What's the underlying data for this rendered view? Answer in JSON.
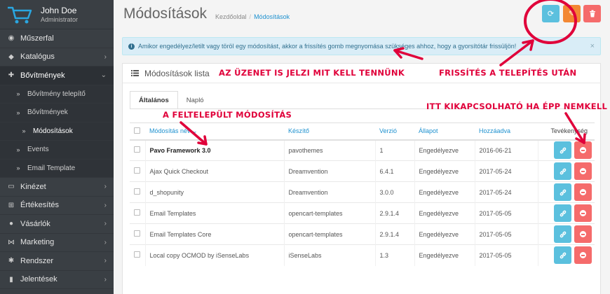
{
  "profile": {
    "name": "John Doe",
    "role": "Administrator"
  },
  "sidebar": {
    "items": [
      {
        "label": "Műszerfal",
        "icon": "dashboard-icon",
        "glyph": "◉",
        "chevron": ""
      },
      {
        "label": "Katalógus",
        "icon": "tag-icon",
        "glyph": "◆",
        "chevron": "›"
      },
      {
        "label": "Bővítmények",
        "icon": "puzzle-icon",
        "glyph": "✚",
        "chevron": "⌄"
      },
      {
        "label": "Bővítmény telepítő",
        "icon": "double-chevron-icon",
        "glyph": "»",
        "chevron": ""
      },
      {
        "label": "Bővítmények",
        "icon": "double-chevron-icon",
        "glyph": "»",
        "chevron": ""
      },
      {
        "label": "Módosítások",
        "icon": "double-chevron-icon",
        "glyph": "»",
        "chevron": ""
      },
      {
        "label": "Events",
        "icon": "double-chevron-icon",
        "glyph": "»",
        "chevron": ""
      },
      {
        "label": "Email Template",
        "icon": "double-chevron-icon",
        "glyph": "»",
        "chevron": ""
      },
      {
        "label": "Kinézet",
        "icon": "monitor-icon",
        "glyph": "▭",
        "chevron": "›"
      },
      {
        "label": "Értékesítés",
        "icon": "cart-icon",
        "glyph": "⊞",
        "chevron": "›"
      },
      {
        "label": "Vásárlók",
        "icon": "user-icon",
        "glyph": "●",
        "chevron": "›"
      },
      {
        "label": "Marketing",
        "icon": "share-icon",
        "glyph": "⋈",
        "chevron": "›"
      },
      {
        "label": "Rendszer",
        "icon": "cog-icon",
        "glyph": "✱",
        "chevron": "›"
      },
      {
        "label": "Jelentések",
        "icon": "chart-icon",
        "glyph": "▮",
        "chevron": "›"
      }
    ]
  },
  "header": {
    "title": "Módosítások",
    "breadcrumb": [
      "Kezdőoldal",
      "/",
      "Módosítások"
    ],
    "buttons": {
      "refresh": "⟳",
      "clear": "✎",
      "delete": "🗑"
    }
  },
  "alert": {
    "text": "Amikor engedélyez/letilt vagy töröl egy módosítást, akkor a frissítés gomb megnyomása szükséges ahhoz, hogy a gyorsítótár frissüljön!",
    "close": "×",
    "info": "i"
  },
  "panel": {
    "title": "Módosítások lista"
  },
  "tabs": [
    "Általános",
    "Napló"
  ],
  "table": {
    "headers": [
      "Módosítás név ⌄",
      "Készítő",
      "Verzió",
      "Állapot",
      "Hozzáadva",
      "Tevékenység"
    ],
    "rows": [
      {
        "name": "Pavo Framework 3.0",
        "author": "pavothemes",
        "version": "1",
        "status": "Engedélyezve",
        "date": "2016-06-21"
      },
      {
        "name": "Ajax Quick Checkout",
        "author": "Dreamvention",
        "version": "6.4.1",
        "status": "Engedélyezve",
        "date": "2017-05-24"
      },
      {
        "name": "d_shopunity",
        "author": "Dreamvention",
        "version": "3.0.0",
        "status": "Engedélyezve",
        "date": "2017-05-24"
      },
      {
        "name": "Email Templates",
        "author": "opencart-templates",
        "version": "2.9.1.4",
        "status": "Engedélyezve",
        "date": "2017-05-05"
      },
      {
        "name": "Email Templates Core",
        "author": "opencart-templates",
        "version": "2.9.1.4",
        "status": "Engedélyezve",
        "date": "2017-05-05"
      },
      {
        "name": "Local copy OCMOD by iSenseLabs",
        "author": "iSenseLabs",
        "version": "1.3",
        "status": "Engedélyezve",
        "date": "2017-05-05"
      }
    ]
  },
  "annotations": {
    "message": "AZ ÜZENET IS JELZI MIT KELL TENNÜNK",
    "refresh": "FRISSÍTÉS A TELEPÍTÉS UTÁN",
    "installed": "A FELTELEPÜLT MÓDOSÍTÁS",
    "disable": "ITT KIKAPCSOLHATÓ HA ÉPP NEMKELL"
  },
  "colors": {
    "annotation": "#e0003a",
    "info": "#5bc0de",
    "danger": "#f56b6b",
    "warning": "#f38733",
    "sidebar": "#3a3f44"
  }
}
